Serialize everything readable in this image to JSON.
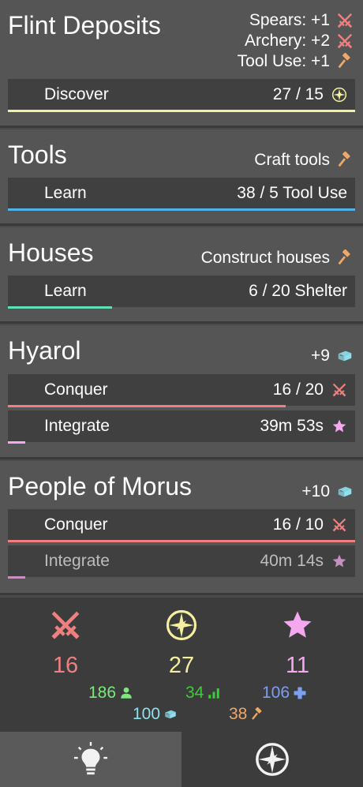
{
  "colors": {
    "military": "#f08080",
    "exploration": "#f5f0a0",
    "culture": "#f5a8ef",
    "tool": "#f0a868",
    "water": "#8fe0ef",
    "people": "#7de87d",
    "growth": "#3ccc3c",
    "health": "#7d9ff0",
    "teal": "#5fe0b8",
    "blue": "#4fb3e8"
  },
  "cards": [
    {
      "title": "Flint Deposits",
      "bonuses": [
        {
          "text": "Spears: +1",
          "icon": "crossed-swords-icon"
        },
        {
          "text": "Archery: +2",
          "icon": "crossed-swords-icon"
        },
        {
          "text": "Tool Use: +1",
          "icon": "hammer-icon"
        }
      ],
      "actions": [
        {
          "label": "Discover",
          "value": "27 / 15",
          "icon": "compass-icon",
          "progress": 1.0
        }
      ]
    },
    {
      "title": "Tools",
      "bonuses": [
        {
          "text": "Craft tools",
          "icon": "hammer-icon"
        }
      ],
      "actions": [
        {
          "label": "Learn",
          "value": "38 / 5 Tool Use",
          "progress": 1.0
        }
      ]
    },
    {
      "title": "Houses",
      "bonuses": [
        {
          "text": "Construct houses",
          "icon": "hammer-icon"
        }
      ],
      "actions": [
        {
          "label": "Learn",
          "value": "6 / 20 Shelter",
          "progress": 0.3
        }
      ]
    },
    {
      "title": "Hyarol",
      "bonuses": [
        {
          "text": "+9",
          "icon": "water-icon"
        }
      ],
      "actions": [
        {
          "label": "Conquer",
          "value": "16 / 20",
          "icon": "crossed-swords-icon",
          "progress": 0.8
        },
        {
          "label": "Integrate",
          "value": "39m 53s",
          "icon": "star-icon",
          "progress": 0.05
        }
      ]
    },
    {
      "title": "People of Morus",
      "bonuses": [
        {
          "text": "+10",
          "icon": "water-icon"
        }
      ],
      "actions": [
        {
          "label": "Conquer",
          "value": "16 / 10",
          "icon": "crossed-swords-icon",
          "progress": 1.0
        },
        {
          "label": "Integrate",
          "value": "40m 14s",
          "icon": "star-icon",
          "progress": 0.05
        }
      ]
    }
  ],
  "stats": {
    "military": "16",
    "exploration": "27",
    "culture": "11",
    "people": "186",
    "growth": "34",
    "health": "106",
    "water": "100",
    "tools": "38"
  },
  "tabs": [
    {
      "icon": "lightbulb-icon",
      "active": true
    },
    {
      "icon": "compass-icon",
      "active": false
    }
  ]
}
